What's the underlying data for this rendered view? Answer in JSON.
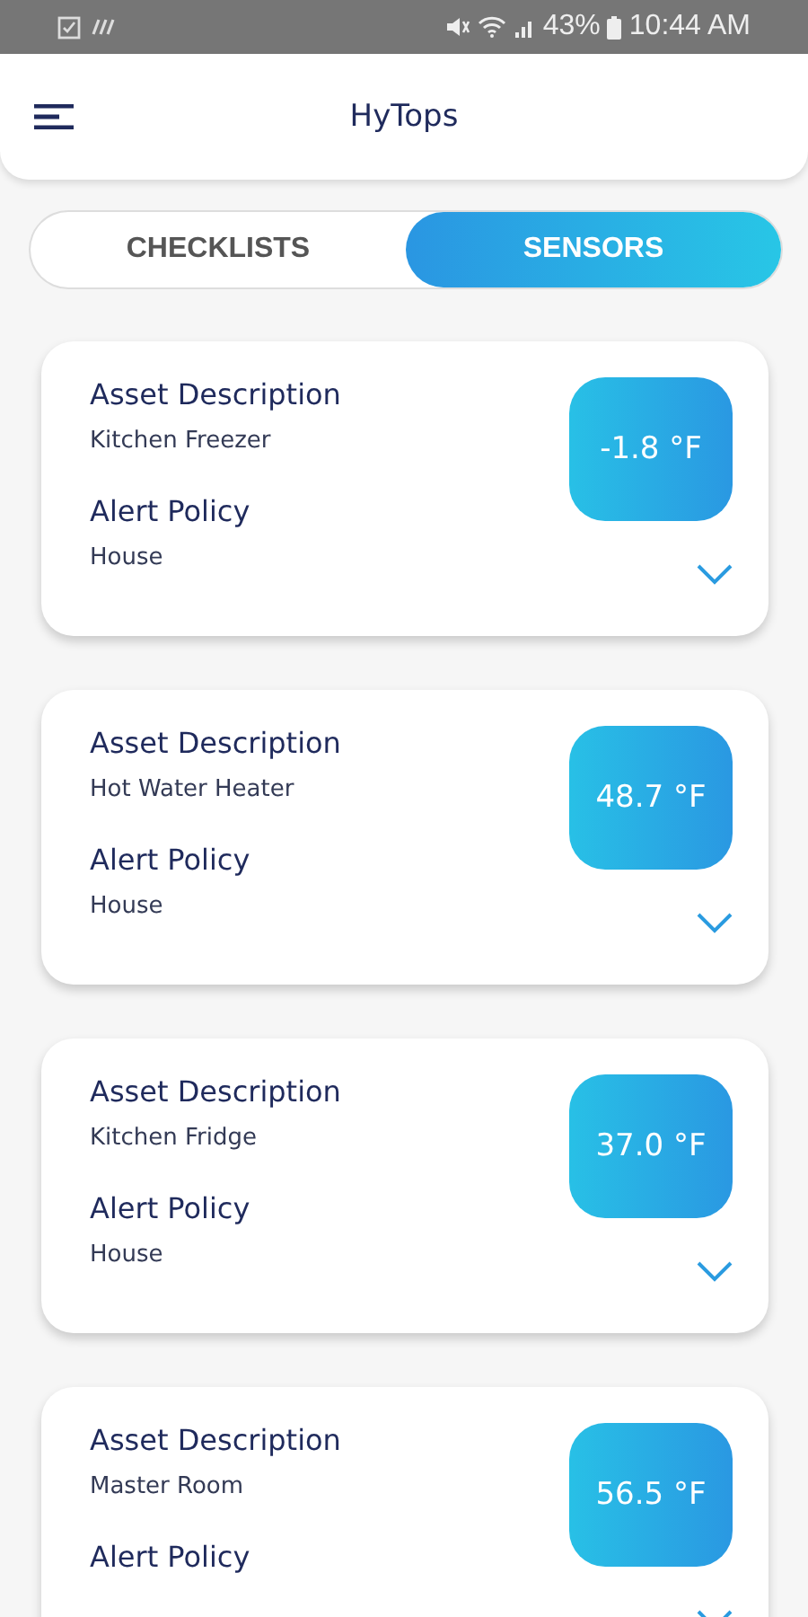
{
  "status_bar": {
    "battery": "43%",
    "time": "10:44 AM"
  },
  "header": {
    "title": "HyTops"
  },
  "tabs": [
    {
      "label": "CHECKLISTS",
      "selected": false
    },
    {
      "label": "SENSORS",
      "selected": true
    }
  ],
  "sensors": [
    {
      "asset_label": "Asset Description",
      "asset": "Kitchen Freezer",
      "policy_label": "Alert Policy",
      "policy": "House",
      "reading": "-1.8 °F",
      "expanded": false
    },
    {
      "asset_label": "Asset Description",
      "asset": "Hot Water Heater",
      "policy_label": "Alert Policy",
      "policy": "House",
      "reading": "48.7 °F",
      "expanded": false
    },
    {
      "asset_label": "Asset Description",
      "asset": "Kitchen Fridge",
      "policy_label": "Alert Policy",
      "policy": "House",
      "reading": "37.0 °F",
      "expanded": false
    },
    {
      "asset_label": "Asset Description",
      "asset": "Master Room",
      "policy_label": "Alert Policy",
      "reading": "56.5 °F",
      "expanded": false
    }
  ]
}
